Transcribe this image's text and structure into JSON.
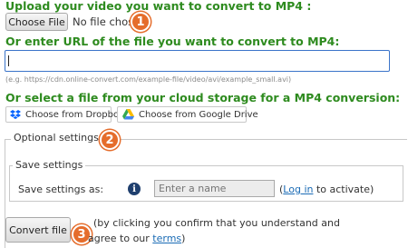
{
  "upload": {
    "heading": "Upload your video you want to convert to MP4 :",
    "choose_file_label": "Choose File",
    "no_file_text": "No file chose"
  },
  "url": {
    "heading": "Or enter URL of the file you want to convert to MP4:",
    "value": "",
    "example": "(e.g. https://cdn.online-convert.com/example-file/video/avi/example_small.avi)"
  },
  "cloud": {
    "heading": "Or select a file from your cloud storage for a MP4 conversion:",
    "dropbox_label": "Choose from Dropbox",
    "gdrive_label": "Choose from Google Drive"
  },
  "optional": {
    "legend": "Optional settings"
  },
  "save_settings": {
    "legend": "Save settings",
    "label": "Save settings as:",
    "info_icon": "i",
    "name_placeholder": "Enter a name",
    "paren_open": "(",
    "login_link": "Log in",
    "activate_text": " to activate)"
  },
  "convert": {
    "button_label": "Convert file",
    "note_line1": "(by clicking you confirm that you understand and",
    "note_line2_prefix": "agree to our ",
    "terms_link": "terms",
    "note_line2_suffix": ")"
  },
  "badges": [
    "1",
    "2",
    "3"
  ],
  "colors": {
    "heading_green": "#2e8b1f",
    "badge_orange": "#e56d2c",
    "link_blue": "#1a6bb5",
    "input_border": "#3b74c9"
  },
  "icons": {
    "dropbox": "dropbox-icon",
    "gdrive": "google-drive-icon",
    "info": "info-icon"
  }
}
